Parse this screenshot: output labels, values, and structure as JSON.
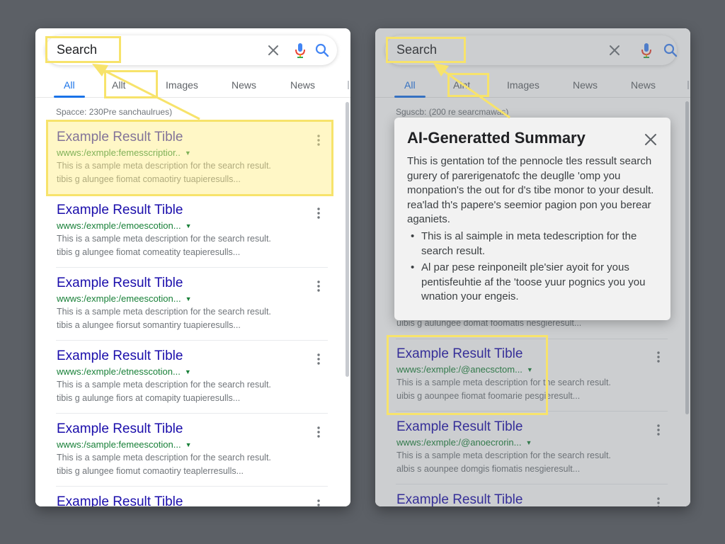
{
  "colors": {
    "background": "#5c6066",
    "link_title": "#1a0dab",
    "link_url": "#188038",
    "accent": "#1a73e8",
    "highlight": "#f7e36b"
  },
  "left": {
    "search": {
      "value": "Search"
    },
    "icons": {
      "clear": "close-icon",
      "mic": "mic-icon",
      "search": "search-icon",
      "more": "more-vert-icon"
    },
    "tabs": [
      "All",
      "Allt",
      "Images",
      "News",
      "News"
    ],
    "stats": "Spacce: 230Pre sanchaulrues)",
    "results": [
      {
        "title": "Example Result Tible",
        "url": "wwws:/exmple:femesscriptior..",
        "desc1": "This is a sample meta description for the search result.",
        "desc2": "tibis g alungee fiomat comaotiry tuapieresulls..."
      },
      {
        "title": "Example Result Tible",
        "url": "wwws:/exmple:/emoescotion...",
        "desc1": "This is a sample meta description for the search result.",
        "desc2": "tibis g alungee fiomat comeatity teapieresulls..."
      },
      {
        "title": "Example Result Tible",
        "url": "wwws:/exmple:/emeescotion...",
        "desc1": "This is a sample meta description for the search result.",
        "desc2": "tibis a alungee fiorsut somantiry tuapieresulls..."
      },
      {
        "title": "Example Result Tible",
        "url": "wwws:/exmple:/etnesscotion...",
        "desc1": "This is a sample meta description for the search result.",
        "desc2": "tibis g aulunge fiors at comapity tuapieresulls..."
      },
      {
        "title": "Example Result Tible",
        "url": "wwws:/sample:femeescotion...",
        "desc1": "This is a sample meta description for the search result.",
        "desc2": "tibis g alungee fiomut comaotiry teaplerresulls..."
      },
      {
        "title": "Example Result Tible"
      }
    ]
  },
  "right": {
    "search": {
      "value": "Search"
    },
    "icons": {
      "clear": "close-icon",
      "mic": "mic-icon",
      "search": "search-icon",
      "more": "more-vert-icon"
    },
    "tabs": [
      "All",
      "Alnt",
      "Images",
      "News",
      "News"
    ],
    "stats": "Sguscb: (200 re searcmawas)",
    "summary": {
      "title": "AI-Generatted Summary",
      "paragraph": "This is gentation tof the pennocle tles ressult search gurery of parerigenatofc the deuglle 'omp you monpation's the out for d's tibe monor to your desult. rea'lad th's papere's seemior pagion pon you berear aganiets.",
      "bullets": [
        "This is al saimple in meta tedescription for the search result.",
        "Al par pese reinponeilt ple'sier ayoit for yous pentisfeuhtie af the 'toose yuur pognics you you wnation your engeis."
      ]
    },
    "partial_desc": "uibis g aulungee domat foomatis nesgieresult...",
    "results": [
      {
        "title": "Example Result Tible",
        "url": "wwws:/exmple:/@anecsctom...",
        "desc1": "This is a sample meta description for the search result.",
        "desc2": "uibis g aounpee fiomat foomarie pesgieresult..."
      },
      {
        "title": "Example Result Tible",
        "url": "wwws:/exmple:/@anoecrorin...",
        "desc1": "This is a sample meta description for the search result.",
        "desc2": "albis s aounpee domgis fiomatis nesgieresult..."
      },
      {
        "title": "Example Result Tible"
      }
    ]
  }
}
